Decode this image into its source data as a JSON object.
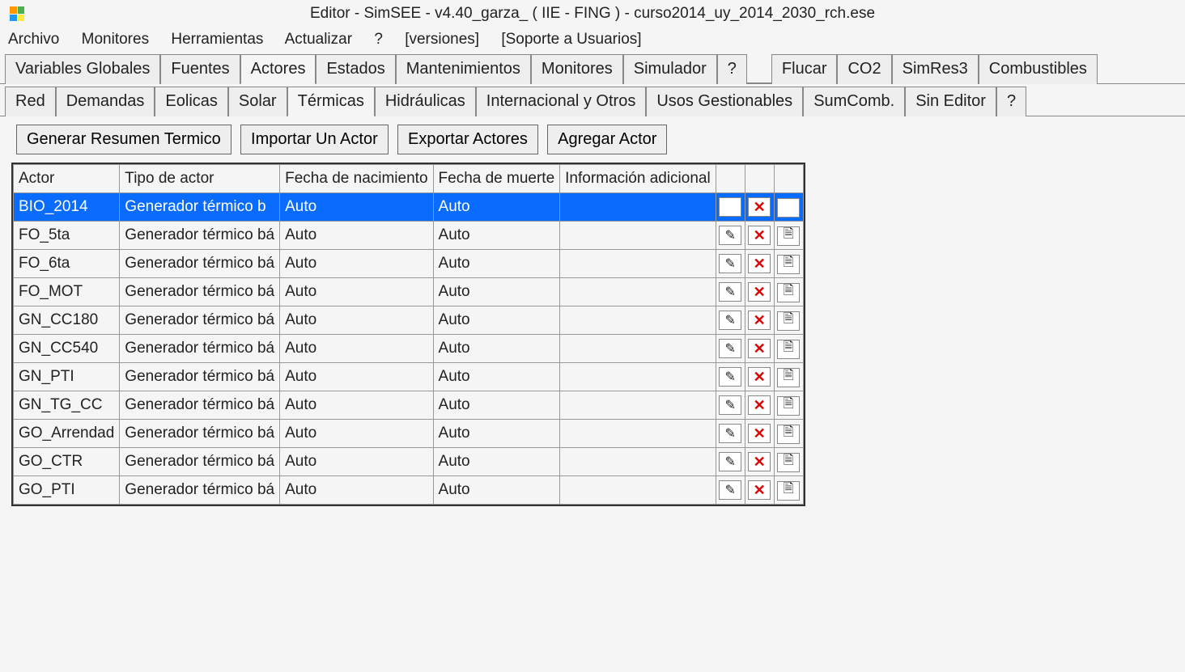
{
  "window_title": "Editor - SimSEE - v4.40_garza_ ( IIE - FING ) - curso2014_uy_2014_2030_rch.ese",
  "menu": {
    "archivo": "Archivo",
    "monitores": "Monitores",
    "herramientas": "Herramientas",
    "actualizar": "Actualizar",
    "q": "?",
    "versiones": "[versiones]",
    "soporte": "[Soporte a Usuarios]"
  },
  "tabs1": {
    "vars": "Variables Globales",
    "fuentes": "Fuentes",
    "actores": "Actores",
    "estados": "Estados",
    "mant": "Mantenimientos",
    "monit": "Monitores",
    "sim": "Simulador",
    "q": "?",
    "flucar": "Flucar",
    "co2": "CO2",
    "simres": "SimRes3",
    "comb": "Combustibles"
  },
  "tabs2": {
    "red": "Red",
    "dem": "Demandas",
    "eol": "Eolicas",
    "solar": "Solar",
    "term": "Térmicas",
    "hidro": "Hidráulicas",
    "intl": "Internacional y Otros",
    "usos": "Usos Gestionables",
    "sumc": "SumComb.",
    "sined": "Sin Editor",
    "q": "?"
  },
  "toolbar": {
    "res": "Generar Resumen Termico",
    "imp": "Importar Un Actor",
    "exp": "Exportar Actores",
    "add": "Agregar Actor"
  },
  "cols": {
    "actor": "Actor",
    "tipo": "Tipo de actor",
    "fnac": "Fecha de nacimiento",
    "fmue": "Fecha de muerte",
    "info": "Información adicional"
  },
  "rows": [
    {
      "actor": "BIO_2014",
      "tipo": "Generador térmico b",
      "fnac": "Auto",
      "fmue": "Auto",
      "info": "",
      "sel": true
    },
    {
      "actor": "FO_5ta",
      "tipo": "Generador térmico bá",
      "fnac": "Auto",
      "fmue": "Auto",
      "info": ""
    },
    {
      "actor": "FO_6ta",
      "tipo": "Generador térmico bá",
      "fnac": "Auto",
      "fmue": "Auto",
      "info": ""
    },
    {
      "actor": "FO_MOT",
      "tipo": "Generador térmico bá",
      "fnac": "Auto",
      "fmue": "Auto",
      "info": ""
    },
    {
      "actor": "GN_CC180",
      "tipo": "Generador térmico bá",
      "fnac": "Auto",
      "fmue": "Auto",
      "info": ""
    },
    {
      "actor": "GN_CC540",
      "tipo": "Generador térmico bá",
      "fnac": "Auto",
      "fmue": "Auto",
      "info": ""
    },
    {
      "actor": "GN_PTI",
      "tipo": "Generador térmico bá",
      "fnac": "Auto",
      "fmue": "Auto",
      "info": ""
    },
    {
      "actor": "GN_TG_CC",
      "tipo": "Generador térmico bá",
      "fnac": "Auto",
      "fmue": "Auto",
      "info": ""
    },
    {
      "actor": "GO_Arrendad",
      "tipo": "Generador térmico bá",
      "fnac": "Auto",
      "fmue": "Auto",
      "info": ""
    },
    {
      "actor": "GO_CTR",
      "tipo": "Generador térmico bá",
      "fnac": "Auto",
      "fmue": "Auto",
      "info": ""
    },
    {
      "actor": "GO_PTI",
      "tipo": "Generador térmico bá",
      "fnac": "Auto",
      "fmue": "Auto",
      "info": ""
    }
  ]
}
